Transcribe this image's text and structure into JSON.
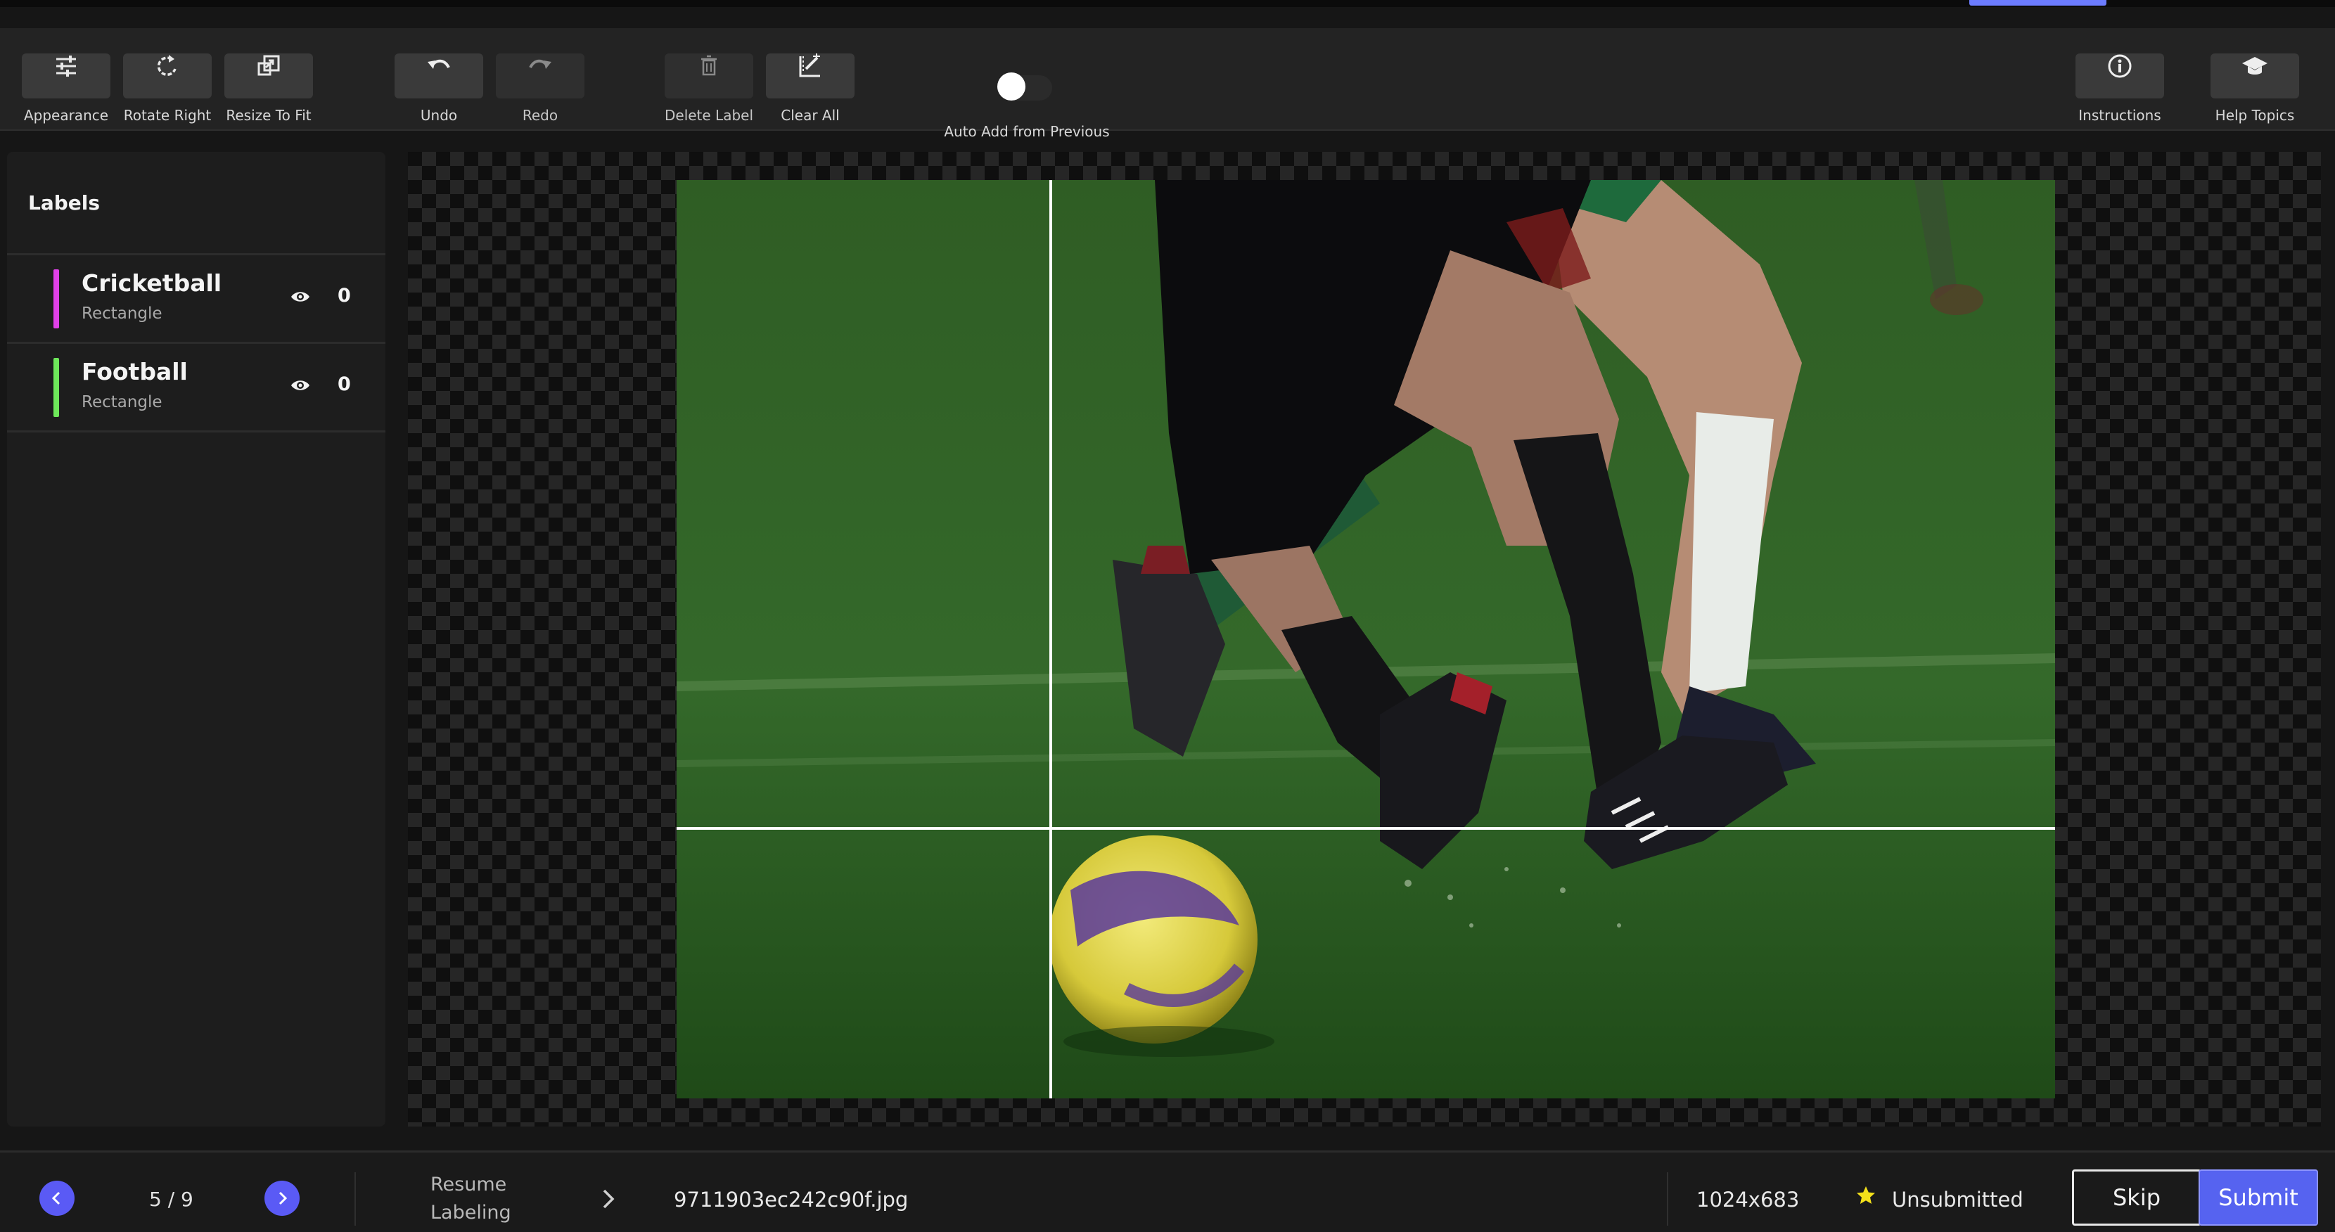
{
  "toolbar": {
    "appearance": "Appearance",
    "rotate_right": "Rotate Right",
    "resize_to_fit": "Resize To Fit",
    "undo": "Undo",
    "redo": "Redo",
    "delete_label": "Delete Label",
    "clear_all": "Clear All",
    "auto_add": "Auto Add from Previous",
    "auto_add_enabled": false,
    "instructions": "Instructions",
    "help_topics": "Help Topics"
  },
  "sidebar": {
    "title": "Labels",
    "labels": [
      {
        "name": "Cricketball",
        "type": "Rectangle",
        "count": "0",
        "color": "#e040e8",
        "icon": "eye-icon"
      },
      {
        "name": "Football",
        "type": "Rectangle",
        "count": "0",
        "color": "#6ee85a",
        "icon": "eye-icon"
      }
    ]
  },
  "footer": {
    "pager": "5 / 9",
    "resume": "Resume Labeling",
    "filename": "9711903ec242c90f.jpg",
    "dimensions": "1024x683",
    "status": "Unsubmitted",
    "skip": "Skip",
    "submit": "Submit"
  },
  "colors": {
    "accent": "#5a5af5",
    "submit": "#5663f0",
    "star": "#f4e11a"
  }
}
